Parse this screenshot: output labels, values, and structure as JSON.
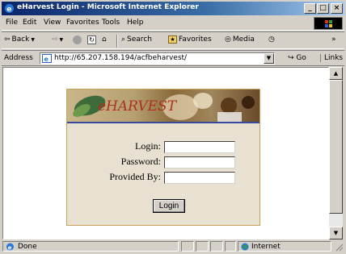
{
  "window": {
    "title": "eHarvest Login - Microsoft Internet Explorer"
  },
  "menu": [
    "File",
    "Edit",
    "View",
    "Favorites",
    "Tools",
    "Help"
  ],
  "toolbar": {
    "back": "Back",
    "search": "Search",
    "favorites": "Favorites",
    "media": "Media"
  },
  "address": {
    "label": "Address",
    "url": "http://65.207.158.194/acfbeharvest/",
    "go": "Go",
    "links": "Links"
  },
  "page": {
    "logo": "eHARVEST",
    "fields": [
      {
        "label": "Login:",
        "value": ""
      },
      {
        "label": "Password:",
        "value": ""
      },
      {
        "label": "Provided By:",
        "value": ""
      }
    ],
    "login_button": "Login"
  },
  "status": {
    "text": "Done",
    "zone": "Internet"
  },
  "colors": {
    "titlebar": "#0a246a",
    "panel_bg": "#e8e0d0",
    "panel_border": "#c9a25a",
    "logo": "#b03020",
    "banner_rule": "#3a4a9a"
  }
}
